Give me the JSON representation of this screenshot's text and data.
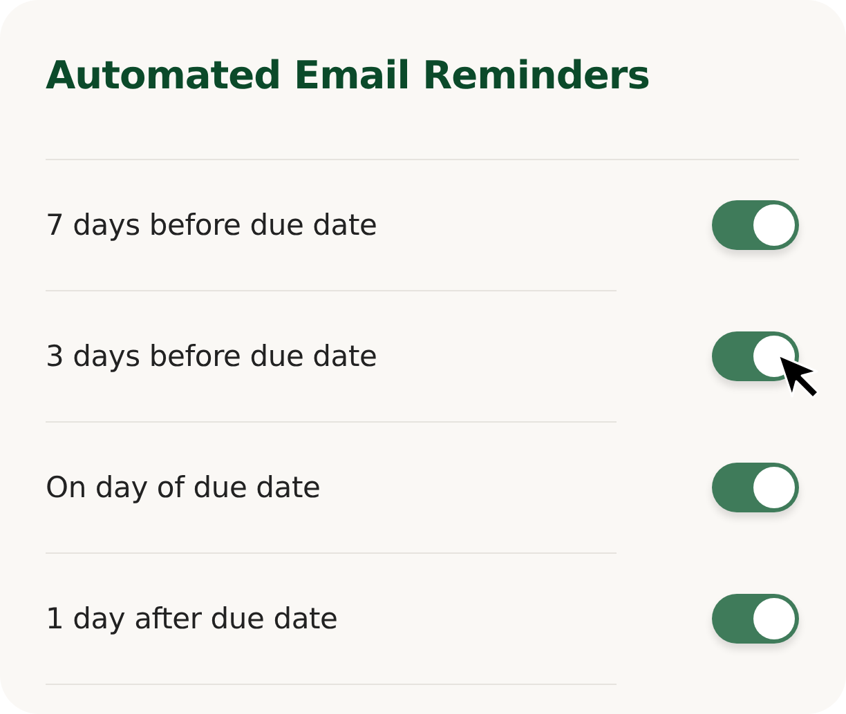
{
  "title": "Automated Email Reminders",
  "reminders": [
    {
      "label": "7 days before due date",
      "on": true
    },
    {
      "label": "3 days before due date",
      "on": true,
      "pointer": true
    },
    {
      "label": "On day of due date",
      "on": true
    },
    {
      "label": "1 day after due date",
      "on": true
    }
  ]
}
